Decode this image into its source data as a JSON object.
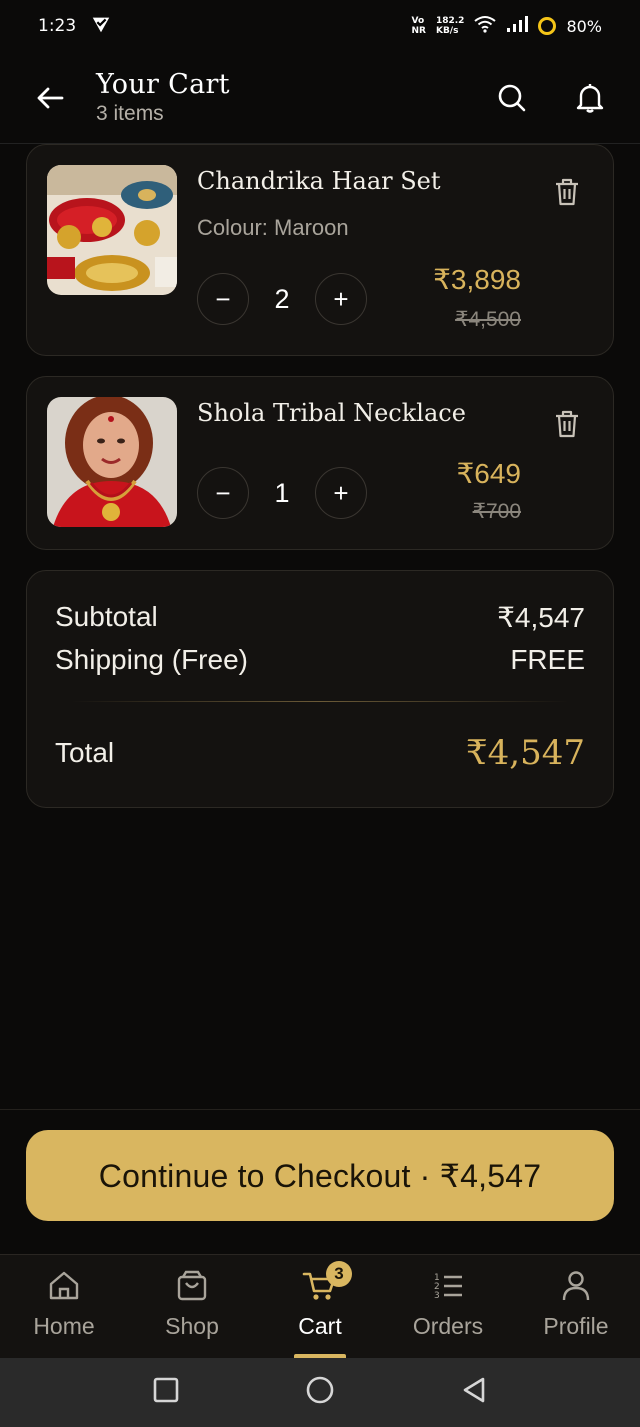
{
  "status_bar": {
    "time": "1:23",
    "network_top": "Vo",
    "network_bottom": "NR",
    "speed_top": "182.2",
    "speed_bottom": "KB/s",
    "battery": "80%",
    "battery_color": "#f5c518"
  },
  "header": {
    "title": "Your Cart",
    "subtitle": "3 items"
  },
  "items": [
    {
      "name": "Chandrika Haar Set",
      "variant": "Colour: Maroon",
      "quantity": "2",
      "price": "₹3,898",
      "old_price": "₹4,500",
      "decrement": "−",
      "increment": "+"
    },
    {
      "name": "Shola Tribal Necklace",
      "quantity": "1",
      "price": "₹649",
      "old_price": "₹700",
      "decrement": "−",
      "increment": "+"
    }
  ],
  "summary": {
    "subtotal_label": "Subtotal",
    "subtotal_value": "₹4,547",
    "shipping_label": "Shipping (Free)",
    "shipping_value": "FREE",
    "total_label": "Total",
    "total_value": "₹4,547"
  },
  "checkout": {
    "label": "Continue to Checkout · ₹4,547"
  },
  "nav": {
    "home": "Home",
    "shop": "Shop",
    "cart": "Cart",
    "cart_badge": "3",
    "orders": "Orders",
    "profile": "Profile"
  },
  "colors": {
    "accent": "#d9b660",
    "price": "#d8b35c",
    "background": "#0b0a09",
    "card": "#141210"
  }
}
